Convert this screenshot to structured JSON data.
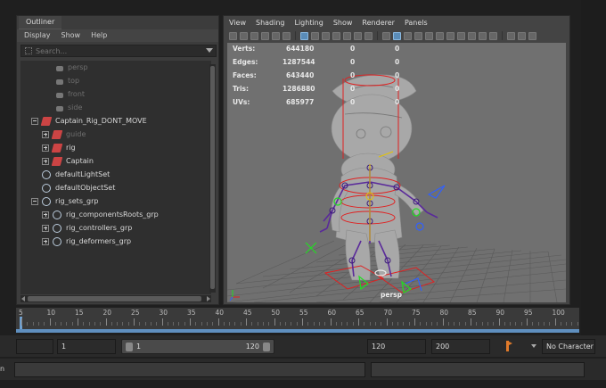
{
  "outliner": {
    "tab": "Outliner",
    "menu": [
      "Display",
      "Show",
      "Help"
    ],
    "search_placeholder": "Search...",
    "items": [
      {
        "label": "persp",
        "icon": "camera-icon"
      },
      {
        "label": "top",
        "icon": "camera-icon"
      },
      {
        "label": "front",
        "icon": "camera-icon"
      },
      {
        "label": "side",
        "icon": "camera-icon"
      },
      {
        "label": "Captain_Rig_DONT_MOVE",
        "icon": "rig-icon"
      },
      {
        "label": "guide",
        "icon": "rig-icon"
      },
      {
        "label": "rig",
        "icon": "rig-icon"
      },
      {
        "label": "Captain",
        "icon": "rig-icon"
      },
      {
        "label": "defaultLightSet",
        "icon": "set-icon"
      },
      {
        "label": "defaultObjectSet",
        "icon": "set-icon"
      },
      {
        "label": "rig_sets_grp",
        "icon": "set-icon"
      },
      {
        "label": "rig_componentsRoots_grp",
        "icon": "set-icon"
      },
      {
        "label": "rig_controllers_grp",
        "icon": "set-icon"
      },
      {
        "label": "rig_deformers_grp",
        "icon": "set-icon"
      }
    ]
  },
  "viewport": {
    "menu": [
      "View",
      "Shading",
      "Lighting",
      "Show",
      "Renderer",
      "Panels"
    ],
    "hud": [
      {
        "label": "Verts:",
        "value": "644180",
        "sel": "0",
        "comp": "0"
      },
      {
        "label": "Edges:",
        "value": "1287544",
        "sel": "0",
        "comp": "0"
      },
      {
        "label": "Faces:",
        "value": "643440",
        "sel": "0",
        "comp": "0"
      },
      {
        "label": "Tris:",
        "value": "1286880",
        "sel": "0",
        "comp": "0"
      },
      {
        "label": "UVs:",
        "value": "685977",
        "sel": "0",
        "comp": "0"
      }
    ],
    "camera": "persp"
  },
  "timeline": {
    "ticks": [
      "5",
      "10",
      "15",
      "20",
      "25",
      "30",
      "35",
      "40",
      "45",
      "50",
      "55",
      "60",
      "65",
      "70",
      "75",
      "80",
      "85",
      "90",
      "95",
      "100"
    ],
    "current_frame": 1
  },
  "range": {
    "start_field": "1",
    "slider_start": "1",
    "slider_end": "120",
    "end_field": "120",
    "max_field": "200",
    "character_set": "No Character Set"
  },
  "colors": {
    "accent": "#5a8cb8",
    "grid": "#555555",
    "skeleton": "#6a2ba0",
    "controller_red": "#e02020",
    "controller_green": "#22dd22",
    "controller_blue": "#3060ff"
  }
}
